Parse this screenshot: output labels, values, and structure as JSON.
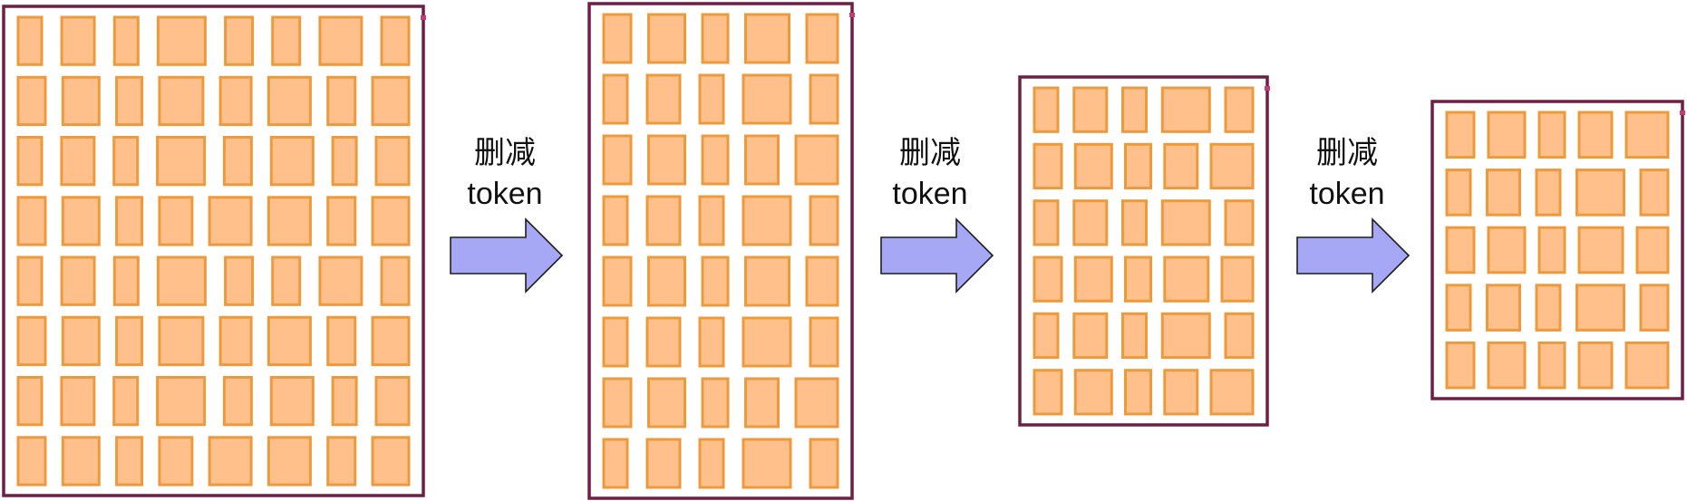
{
  "diagram": {
    "stages": [
      {
        "columns": 8,
        "rows": 8
      },
      {
        "columns": 5,
        "rows": 8
      },
      {
        "columns": 5,
        "rows": 6
      },
      {
        "columns": 5,
        "rows": 5
      }
    ],
    "step_label_top": "删减",
    "step_label_bottom": "token",
    "colors": {
      "frame": "#6e1f45",
      "token_fill": "#ffc08c",
      "token_stroke": "#ec9a3c",
      "arrow_fill": "#a7a8f5",
      "marker": "#c73a74"
    }
  }
}
